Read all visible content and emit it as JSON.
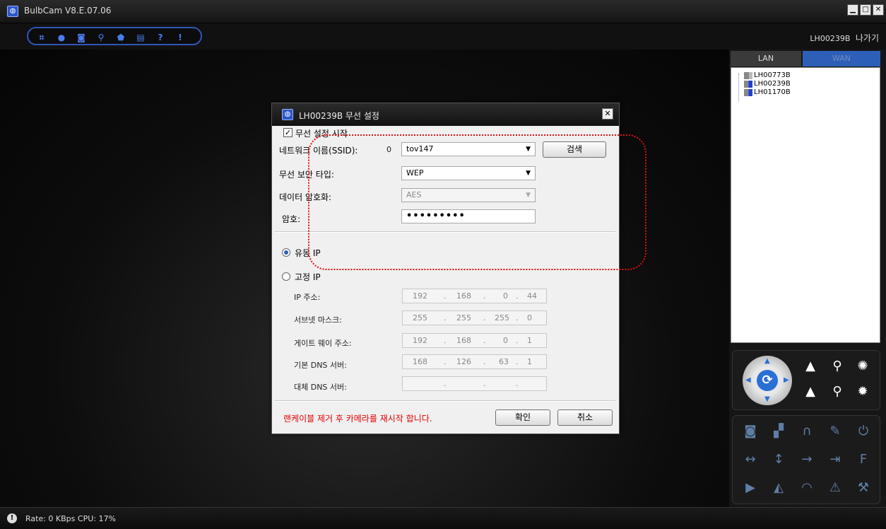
{
  "window": {
    "title": "BulbCam  V8.E.07.06",
    "app_icon": "bulbcam-icon",
    "controls": {
      "minimize": "▁",
      "maximize": "□",
      "close": "✕"
    }
  },
  "toolbar": {
    "icons": [
      "grid-icon",
      "record-icon",
      "snapshot-icon",
      "search-icon",
      "lock-icon",
      "save-icon",
      "help-icon",
      "alert-icon"
    ],
    "glyphs": [
      "⌗",
      "●",
      "◙",
      "⚲",
      "⬟",
      "▤",
      "?",
      "!"
    ],
    "user": "LH00239B",
    "logout": "나가기"
  },
  "right_panel": {
    "tabs": {
      "lan": "LAN",
      "wan": "WAN"
    },
    "devices": [
      "LH00773B",
      "LH00239B",
      "LH01170B"
    ]
  },
  "status": {
    "text": "Rate: 0 KBps  CPU: 17%"
  },
  "dialog": {
    "title": "LH00239B 무선 설정",
    "enable_label": "무선 설정 시작",
    "enable_checked": true,
    "ssid_label": "네트워크 이름(SSID):",
    "ssid_count": "0",
    "ssid_value": "tov147",
    "search_button": "검색",
    "security_label": "무선 보안 타입:",
    "security_value": "WEP",
    "encryption_label": "데이터 암호화:",
    "encryption_value": "AES",
    "password_label": "암호:",
    "password_value": "•••••••••",
    "dhcp_label": "유동 IP",
    "static_label": "고정 IP",
    "ip_label": "IP 주소:",
    "ip_value": [
      "192",
      "168",
      "0",
      "44"
    ],
    "mask_label": "서브넷 마스크:",
    "mask_value": [
      "255",
      "255",
      "255",
      "0"
    ],
    "gateway_label": "게이트 웨이 주소:",
    "gateway_value": [
      "192",
      "168",
      "0",
      "1"
    ],
    "dns1_label": "기본 DNS 서버:",
    "dns1_value": [
      "168",
      "126",
      "63",
      "1"
    ],
    "dns2_label": "대체 DNS 서버:",
    "dns2_value": [
      "",
      "",
      "",
      ""
    ],
    "dot": ".",
    "warning": "랜케이블 제거 후 카메라를 재시작 합니다.",
    "ok_button": "확인",
    "cancel_button": "취소"
  }
}
